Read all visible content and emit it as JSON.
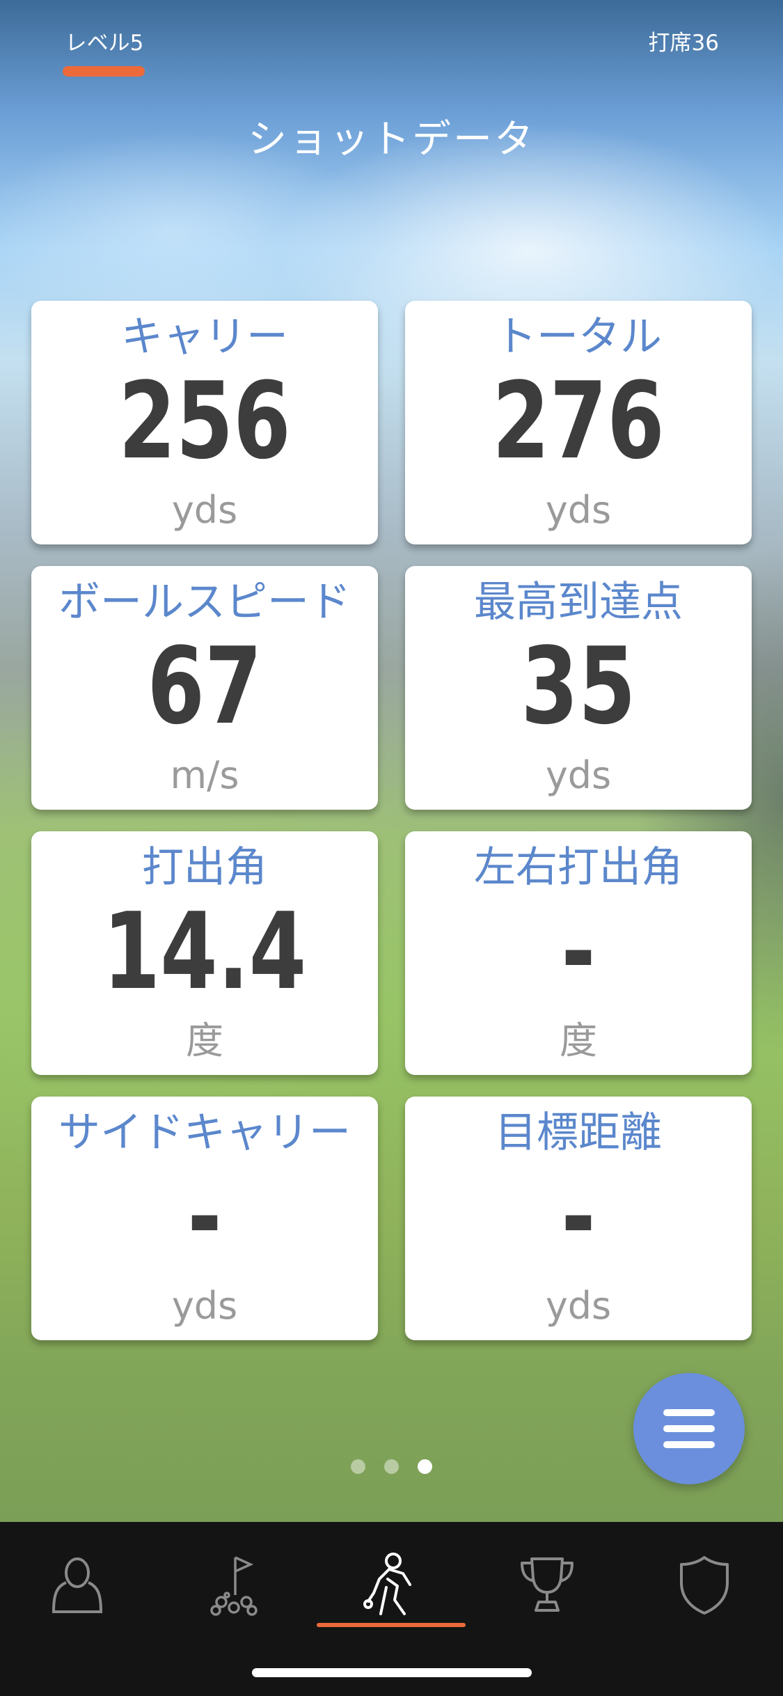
{
  "header": {
    "level_tab": "レベル5",
    "at_bat": "打席36",
    "title": "ショットデータ"
  },
  "cards": [
    {
      "label": "キャリー",
      "value": "256",
      "unit": "yds"
    },
    {
      "label": "トータル",
      "value": "276",
      "unit": "yds"
    },
    {
      "label": "ボールスピード",
      "value": "67",
      "unit": "m/s"
    },
    {
      "label": "最高到達点",
      "value": "35",
      "unit": "yds"
    },
    {
      "label": "打出角",
      "value": "14.4",
      "unit": "度"
    },
    {
      "label": "左右打出角",
      "value": "-",
      "unit": "度"
    },
    {
      "label": "サイドキャリー",
      "value": "-",
      "unit": "yds"
    },
    {
      "label": "目標距離",
      "value": "-",
      "unit": "yds"
    }
  ],
  "pager": {
    "page_count": 3,
    "active_page": 3
  },
  "fab": {
    "icon": "menu-icon"
  },
  "tabbar": {
    "tabs": [
      {
        "icon": "profile-icon"
      },
      {
        "icon": "golf-course-icon"
      },
      {
        "icon": "golfer-swing-icon",
        "active": true
      },
      {
        "icon": "trophy-icon"
      },
      {
        "icon": "shield-icon"
      }
    ]
  },
  "colors": {
    "accent": "#ec6a3a",
    "label_blue": "#5b87cc",
    "fab_blue": "#6b8fdd",
    "value_gray": "#3d3d3d",
    "unit_gray": "#9a9a9a",
    "tabbar_bg": "#141414"
  }
}
